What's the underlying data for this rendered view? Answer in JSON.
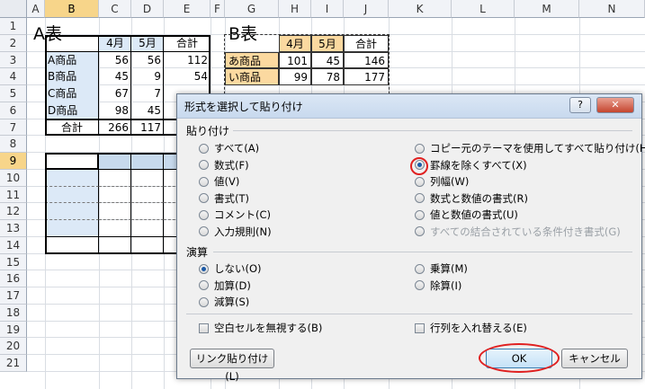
{
  "columns": [
    "A",
    "B",
    "C",
    "D",
    "E",
    "F",
    "G",
    "H",
    "I",
    "J",
    "K",
    "L",
    "M",
    "N"
  ],
  "rows": [
    "1",
    "2",
    "3",
    "4",
    "5",
    "6",
    "7",
    "8",
    "9",
    "10",
    "11",
    "12",
    "13",
    "14",
    "15",
    "16",
    "17",
    "18",
    "19",
    "20",
    "21"
  ],
  "tableA": {
    "title": "A表",
    "headers": [
      "4月",
      "5月",
      "合計"
    ],
    "rows": [
      {
        "label": "A商品",
        "v1": "56",
        "v2": "56",
        "total": "112"
      },
      {
        "label": "B商品",
        "v1": "45",
        "v2": "9",
        "total": "54"
      },
      {
        "label": "C商品",
        "v1": "67",
        "v2": "7",
        "total": ""
      },
      {
        "label": "D商品",
        "v1": "98",
        "v2": "45",
        "total": ""
      }
    ],
    "total_label": "合計",
    "total_v1": "266",
    "total_v2": "117"
  },
  "tableB": {
    "title": "B表",
    "headers": [
      "4月",
      "5月",
      "合計"
    ],
    "rows": [
      {
        "label": "あ商品",
        "v1": "101",
        "v2": "45",
        "total": "146"
      },
      {
        "label": "い商品",
        "v1": "99",
        "v2": "78",
        "total": "177"
      }
    ]
  },
  "dialog": {
    "title": "形式を選択して貼り付け",
    "help_label": "?",
    "close_label": "✕",
    "paste_section": "貼り付け",
    "paste_options_left": [
      "すべて(A)",
      "数式(F)",
      "値(V)",
      "書式(T)",
      "コメント(C)",
      "入力規則(N)"
    ],
    "paste_options_right": [
      "コピー元のテーマを使用してすべて貼り付け(H)",
      "罫線を除くすべて(X)",
      "列幅(W)",
      "数式と数値の書式(R)",
      "値と数値の書式(U)",
      "すべての結合されている条件付き書式(G)"
    ],
    "paste_selected": "罫線を除くすべて(X)",
    "operation_section": "演算",
    "operation_left": [
      "しない(O)",
      "加算(D)",
      "減算(S)"
    ],
    "operation_right": [
      "乗算(M)",
      "除算(I)"
    ],
    "operation_selected": "しない(O)",
    "skip_blanks": "空白セルを無視する(B)",
    "transpose": "行列を入れ替える(E)",
    "paste_link_button": "リンク貼り付け(L)",
    "ok_button": "OK",
    "cancel_button": "キャンセル"
  },
  "colors": {
    "header_selected": "#f7d58a",
    "table_label_fill": "#dce9f7",
    "table_b_header_fill": "#fbd9a0",
    "highlight_ring": "#e02020"
  }
}
